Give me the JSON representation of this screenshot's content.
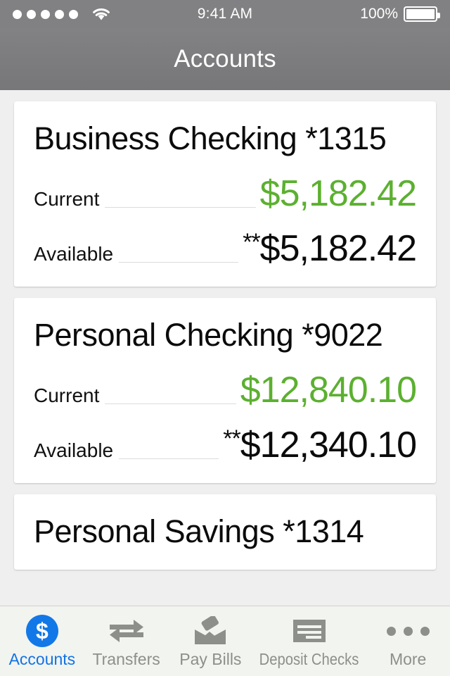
{
  "status_bar": {
    "signal_dots": 5,
    "wifi_icon": "wifi-icon",
    "time": "9:41 AM",
    "battery_percent": "100%",
    "battery_icon": "battery-full-icon"
  },
  "nav": {
    "title": "Accounts"
  },
  "colors": {
    "positive_balance": "#5cb030",
    "accent_blue": "#1278e8",
    "navbar_gray": "#7e7e80",
    "page_background": "#efefef",
    "card_background": "#ffffff"
  },
  "accounts": [
    {
      "title": "Business Checking *1315",
      "rows": [
        {
          "label": "Current",
          "value": "$5,182.42",
          "stars": "",
          "color": "green"
        },
        {
          "label": "Available",
          "value": "$5,182.42",
          "stars": "**",
          "color": "dark"
        }
      ]
    },
    {
      "title": "Personal Checking *9022",
      "rows": [
        {
          "label": "Current",
          "value": "$12,840.10",
          "stars": "",
          "color": "green"
        },
        {
          "label": "Available",
          "value": "$12,340.10",
          "stars": "**",
          "color": "dark"
        }
      ]
    },
    {
      "title": "Personal Savings *1314",
      "rows": []
    }
  ],
  "tabs": [
    {
      "label": "Accounts",
      "icon": "dollar-circle-icon",
      "active": true
    },
    {
      "label": "Transfers",
      "icon": "transfer-arrows-icon",
      "active": false
    },
    {
      "label": "Pay Bills",
      "icon": "envelope-icon",
      "active": false
    },
    {
      "label": "Deposit Checks",
      "icon": "check-lines-icon",
      "active": false
    },
    {
      "label": "More",
      "icon": "ellipsis-icon",
      "active": false
    }
  ]
}
